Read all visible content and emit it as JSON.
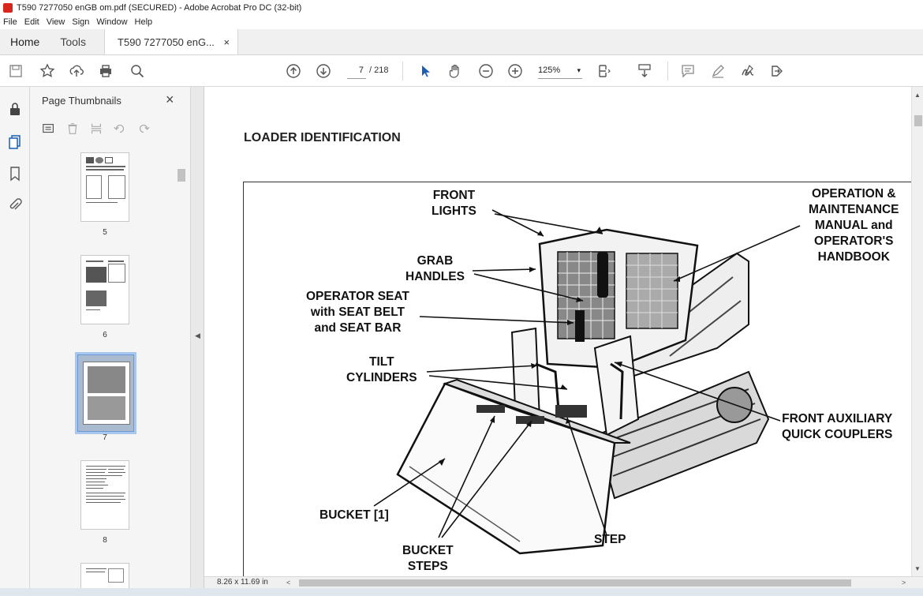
{
  "window": {
    "title": "T590 7277050 enGB om.pdf (SECURED) - Adobe Acrobat Pro DC (32-bit)"
  },
  "menu": [
    "File",
    "Edit",
    "View",
    "Sign",
    "Window",
    "Help"
  ],
  "tabs": {
    "home": "Home",
    "tools": "Tools",
    "doc": "T590 7277050 enG...",
    "close": "×"
  },
  "toolbar": {
    "page_current": "7",
    "page_total": "/ 218",
    "zoom": "125%",
    "zoom_arrow": "▾"
  },
  "thumbnails": {
    "title": "Page Thumbnails",
    "close": "×",
    "pages": [
      {
        "label": "5",
        "selected": false
      },
      {
        "label": "6",
        "selected": false
      },
      {
        "label": "7",
        "selected": true
      },
      {
        "label": "8",
        "selected": false
      }
    ]
  },
  "document": {
    "heading": "LOADER IDENTIFICATION",
    "callouts": {
      "front_lights": "FRONT\nLIGHTS",
      "operation_manual": "OPERATION &\nMAINTENANCE\nMANUAL and\nOPERATOR'S\nHANDBOOK",
      "grab_handles": "GRAB\nHANDLES",
      "operator_seat": "OPERATOR SEAT\nwith SEAT BELT\nand SEAT BAR",
      "tilt_cylinders": "TILT\nCYLINDERS",
      "front_aux": "FRONT AUXILIARY\nQUICK COUPLERS",
      "bucket": "BUCKET [1]",
      "step": "STEP",
      "bucket_steps": "BUCKET\nSTEPS"
    }
  },
  "status": {
    "page_size": "8.26 x 11.69 in",
    "left_arrow": "<",
    "right_arrow": ">"
  }
}
